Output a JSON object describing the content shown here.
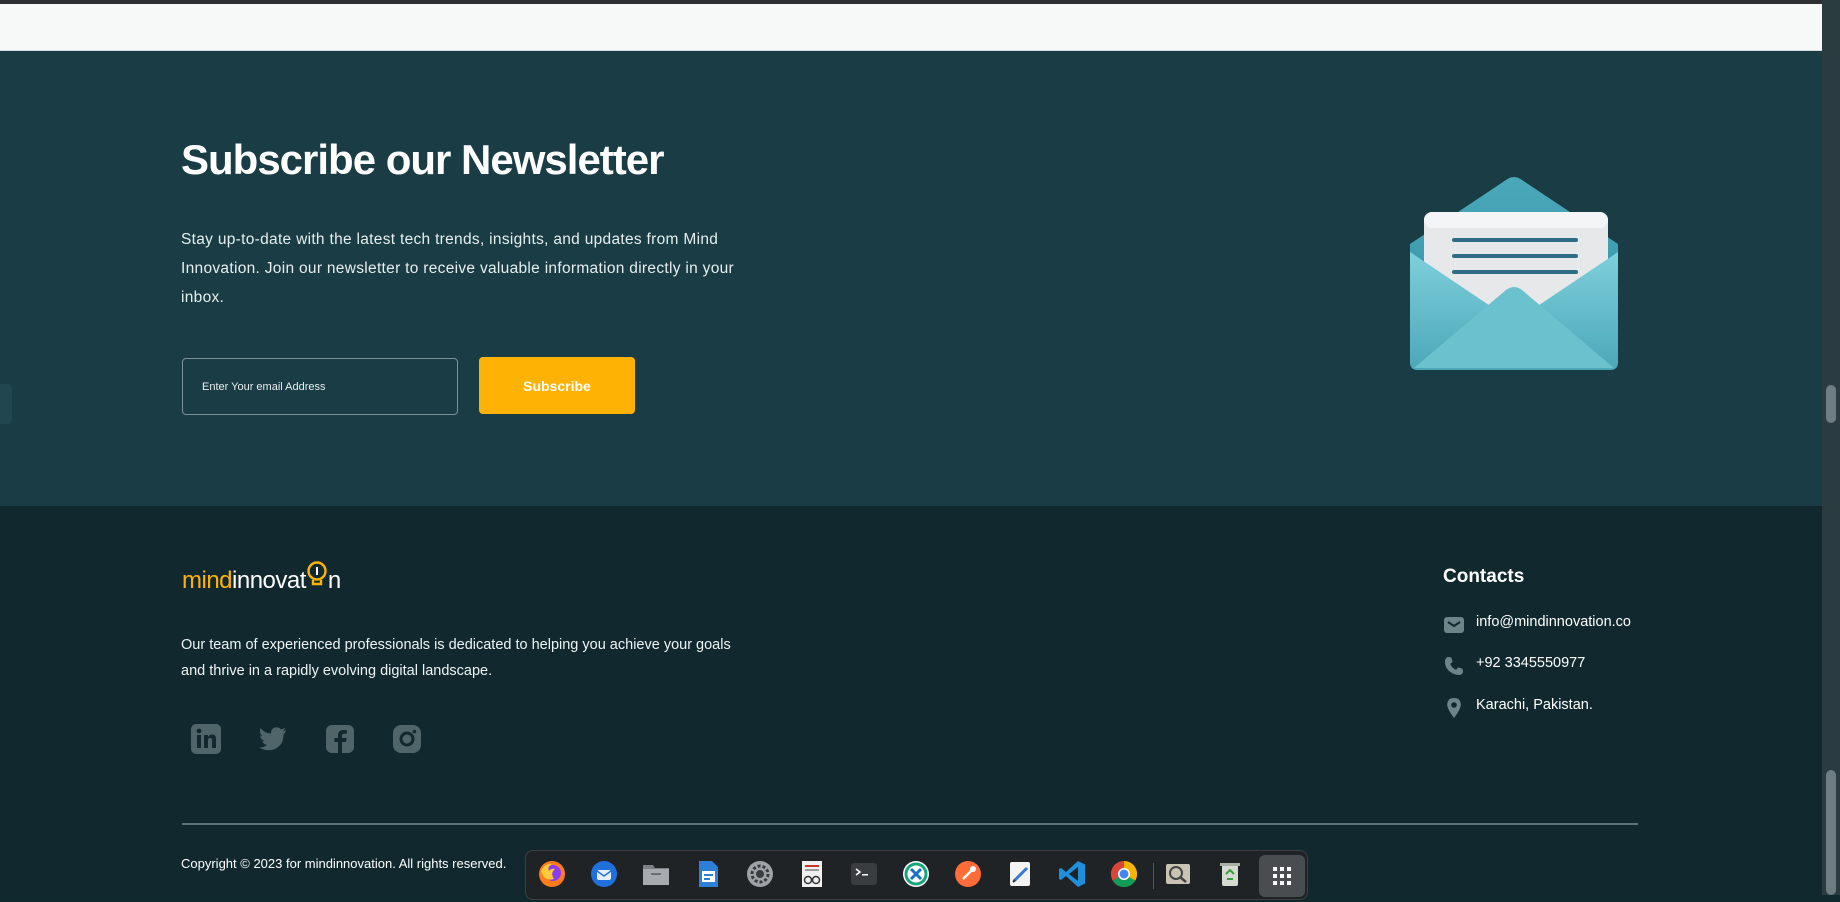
{
  "newsletter": {
    "title": "Subscribe our Newsletter",
    "description": "Stay up-to-date with the latest tech trends, insights, and updates from Mind Innovation. Join our newsletter to receive valuable information directly in your inbox.",
    "email_placeholder": "Enter Your email Address",
    "subscribe_label": "Subscribe"
  },
  "footer": {
    "logo": {
      "part1": "mind",
      "part2": "innovat",
      "part3": "n"
    },
    "description": "Our team of experienced professionals is dedicated to helping you achieve your goals and thrive in a rapidly evolving digital landscape.",
    "social": [
      {
        "name": "LinkedIn",
        "icon": "linkedin-icon"
      },
      {
        "name": "Twitter",
        "icon": "twitter-icon"
      },
      {
        "name": "Facebook",
        "icon": "facebook-icon"
      },
      {
        "name": "Instagram",
        "icon": "instagram-icon"
      }
    ],
    "contacts": {
      "title": "Contacts",
      "email": "info@mindinnovation.co",
      "phone": "+92 3345550977",
      "location": "Karachi, Pakistan."
    },
    "copyright": "Copyright © 2023 for mindinnovation. All rights reserved."
  },
  "dock": {
    "apps": [
      "firefox-icon",
      "thunderbird-icon",
      "files-icon",
      "writer-icon",
      "settings-icon",
      "document-viewer-icon",
      "terminal-icon",
      "remote-desktop-icon",
      "postman-icon",
      "text-editor-icon",
      "vscode-icon",
      "chrome-icon",
      "image-viewer-icon",
      "trash-icon",
      "app-grid-icon"
    ]
  },
  "colors": {
    "newsletter_bg": "#1a3c45",
    "footer_bg": "#11292e",
    "accent": "#feb304",
    "social_icon": "#4f6569",
    "contact_icon": "#6d8589"
  }
}
